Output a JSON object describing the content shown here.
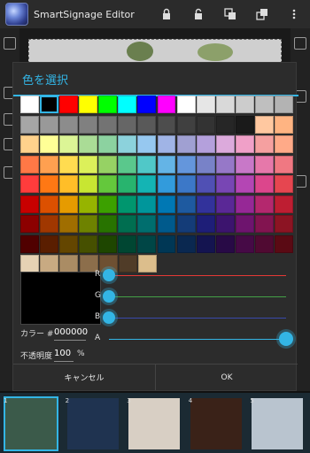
{
  "app": {
    "title": "SmartSignage Editor"
  },
  "toolbar": {
    "icons": [
      "lock-icon",
      "unlock-icon",
      "layers-back-icon",
      "layers-front-icon",
      "overflow-menu-icon"
    ]
  },
  "dialog": {
    "title": "色を選択",
    "palette": [
      [
        "#ffffff",
        "#000000",
        "#ff0000",
        "#ffff00",
        "#00ff00",
        "#00ffff",
        "#0000ff",
        "#ff00ff",
        "#ffffff",
        "#e6e6e6",
        "#d9d9d9",
        "#cccccc",
        "#bfbfbf",
        "#b3b3b3"
      ],
      [
        "#a6a6a6",
        "#999999",
        "#8c8c8c",
        "#808080",
        "#737373",
        "#666666",
        "#595959",
        "#4d4d4d",
        "#404040",
        "#333333",
        "#262626",
        "#1a1a1a",
        "#ffc8a0",
        "#ffb482"
      ],
      [
        "#ffd28c",
        "#ffff96",
        "#dcf596",
        "#aadc96",
        "#8cd2a0",
        "#8cd2dc",
        "#96c8f0",
        "#a0b4e6",
        "#a0a0d2",
        "#b4a0dc",
        "#dcaadc",
        "#f0a0c8",
        "#f5a0a0",
        "#ffaa88"
      ],
      [
        "#ff7846",
        "#ffa050",
        "#ffdc50",
        "#dcf05a",
        "#96d264",
        "#5ac88c",
        "#50c8c8",
        "#64b4e6",
        "#6496dc",
        "#7882c8",
        "#9678c8",
        "#c878c8",
        "#e678aa",
        "#f07882"
      ],
      [
        "#ff3c3c",
        "#ff7814",
        "#ffbe28",
        "#c8e632",
        "#64c83c",
        "#28b46e",
        "#14b4b4",
        "#329bdc",
        "#3c78c8",
        "#5050b4",
        "#7846b4",
        "#b446b4",
        "#dc468c",
        "#e64650"
      ],
      [
        "#c80000",
        "#dc5000",
        "#e69b00",
        "#96b400",
        "#3ca000",
        "#00966e",
        "#00969b",
        "#0078b4",
        "#1e5aa0",
        "#32329b",
        "#5a2896",
        "#962896",
        "#b4286e",
        "#be1e32"
      ],
      [
        "#8c0000",
        "#a03700",
        "#a06e00",
        "#6e8200",
        "#287300",
        "#006e50",
        "#006e6e",
        "#005a8c",
        "#143c78",
        "#1e1e78",
        "#3c146e",
        "#6e146e",
        "#821450",
        "#8c1423"
      ],
      [
        "#500000",
        "#5a1e00",
        "#644600",
        "#465000",
        "#1e4600",
        "#004632",
        "#004646",
        "#003755",
        "#0a2850",
        "#141450",
        "#280a46",
        "#460a46",
        "#500a32",
        "#5a0a14"
      ],
      [
        "#e6d2b4",
        "#c8aa82",
        "#aa8c64",
        "#8c6e4b",
        "#6e5032",
        "#503c28",
        "#dcbe8c"
      ]
    ],
    "selected_hex_label": "カラー #",
    "hex_value": "000000",
    "opacity_label": "不透明度",
    "opacity_value": "100",
    "opacity_unit": "%",
    "sliders": [
      {
        "label": "R",
        "value": 0,
        "color": "#e53935"
      },
      {
        "label": "G",
        "value": 0,
        "color": "#43a047"
      },
      {
        "label": "B",
        "value": 0,
        "color": "#3949ab"
      },
      {
        "label": "A",
        "value": 100,
        "color": "#33b5e5"
      }
    ],
    "cancel_label": "キャンセル",
    "ok_label": "OK"
  },
  "strip": {
    "thumbs": [
      {
        "num": "1",
        "color": "#3b5a4a"
      },
      {
        "num": "2",
        "color": "#1f3350"
      },
      {
        "num": "3",
        "color": "#d8cfc4"
      },
      {
        "num": "4",
        "color": "#3a2218"
      },
      {
        "num": "5",
        "color": "#b9c4cf"
      }
    ]
  }
}
